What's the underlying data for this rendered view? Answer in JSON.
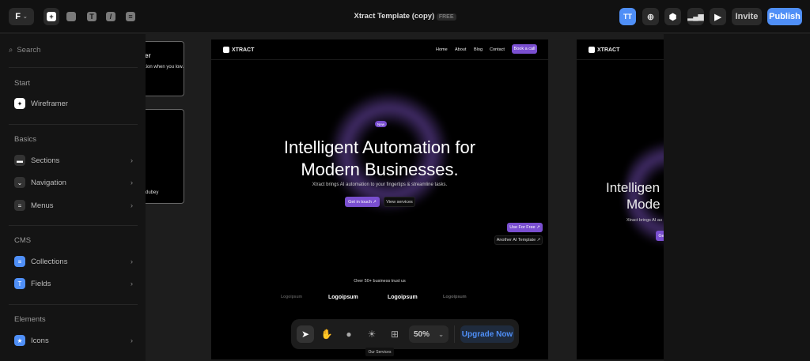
{
  "topbar": {
    "title": "Xtract Template (copy)",
    "plan_badge": "FREE",
    "avatar_initials": "TT",
    "invite_label": "Invite",
    "publish_label": "Publish",
    "accent": "#4f8ff7"
  },
  "sidebar": {
    "search_placeholder": "Search",
    "sections": [
      {
        "title": "Start",
        "items": [
          {
            "label": "Wireframer",
            "icon": "sparkle-icon"
          }
        ]
      },
      {
        "title": "Basics",
        "items": [
          {
            "label": "Sections",
            "icon": "section-icon"
          },
          {
            "label": "Navigation",
            "icon": "chevron-down-icon"
          },
          {
            "label": "Menus",
            "icon": "menu-icon"
          }
        ]
      },
      {
        "title": "CMS",
        "items": [
          {
            "label": "Collections",
            "icon": "database-icon"
          },
          {
            "label": "Fields",
            "icon": "text-icon"
          }
        ]
      },
      {
        "title": "Elements",
        "items": [
          {
            "label": "Icons",
            "icon": "star-icon"
          }
        ]
      }
    ]
  },
  "cards": {
    "card1_title": "er",
    "card1_text": "tion when you low.",
    "card2_text": "dubey"
  },
  "site": {
    "brand": "XTRACT",
    "nav": [
      "Home",
      "About",
      "Blog",
      "Contact"
    ],
    "cta": "Book a call",
    "badge": "New",
    "headline_1": "Intelligent Automation for",
    "headline_2": "Modern Businesses.",
    "subtext": "Xtract brings AI automation to your fingertips & streamline tasks.",
    "primary_btn": "Get in touch ↗",
    "secondary_btn": "View services",
    "use_free": "Use For Free ↗",
    "another": "Another AI Template ↗",
    "trust": "Over 50+ business trust us",
    "logos": [
      "Logoipsum",
      "Logoipsum",
      "Logoipsum",
      "Logoipsum"
    ],
    "accent": "#7a4fd0"
  },
  "preview": {
    "headline_1": "Intelligen",
    "headline_2": "Mode",
    "subtext": "Xtract brings AI au",
    "btn": "Ge"
  },
  "dock": {
    "zoom": "50%",
    "upgrade": "Upgrade Now",
    "tooltip": "Our Services"
  }
}
